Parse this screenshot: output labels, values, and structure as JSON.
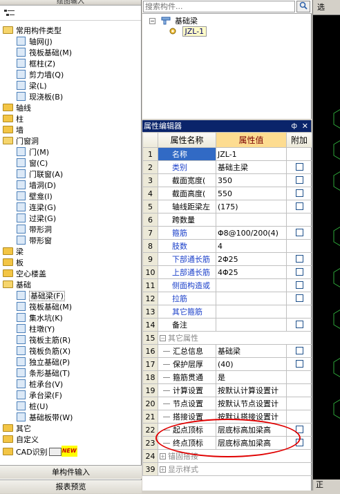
{
  "left_panel": {
    "top_title": "绘图输入",
    "tree": [
      {
        "label": "常用构件类型",
        "level": 0,
        "type": "folder"
      },
      {
        "label": "轴网(J)",
        "level": 1,
        "type": "item",
        "icon": "grid-icon"
      },
      {
        "label": "筏板基础(M)",
        "level": 1,
        "type": "item",
        "icon": "raft-icon"
      },
      {
        "label": "框柱(Z)",
        "level": 1,
        "type": "item",
        "icon": "column-icon"
      },
      {
        "label": "剪力墙(Q)",
        "level": 1,
        "type": "item",
        "icon": "wall-icon"
      },
      {
        "label": "梁(L)",
        "level": 1,
        "type": "item",
        "icon": "beam-icon"
      },
      {
        "label": "现浇板(B)",
        "level": 1,
        "type": "item",
        "icon": "slab-icon"
      },
      {
        "label": "轴线",
        "level": 0,
        "type": "folder"
      },
      {
        "label": "柱",
        "level": 0,
        "type": "folder"
      },
      {
        "label": "墙",
        "level": 0,
        "type": "folder"
      },
      {
        "label": "门窗洞",
        "level": 0,
        "type": "folder"
      },
      {
        "label": "门(M)",
        "level": 1,
        "type": "item",
        "icon": "door-icon"
      },
      {
        "label": "窗(C)",
        "level": 1,
        "type": "item",
        "icon": "window-icon"
      },
      {
        "label": "门联窗(A)",
        "level": 1,
        "type": "item",
        "icon": "door-window-icon"
      },
      {
        "label": "墙洞(D)",
        "level": 1,
        "type": "item",
        "icon": "wall-opening-icon"
      },
      {
        "label": "壁龛(I)",
        "level": 1,
        "type": "item",
        "icon": "niche-icon"
      },
      {
        "label": "连梁(G)",
        "level": 1,
        "type": "item",
        "icon": "coupling-beam-icon"
      },
      {
        "label": "过梁(G)",
        "level": 1,
        "type": "item",
        "icon": "lintel-icon"
      },
      {
        "label": "带形洞",
        "level": 1,
        "type": "item",
        "icon": "strip-opening-icon"
      },
      {
        "label": "带形窗",
        "level": 1,
        "type": "item",
        "icon": "strip-window-icon"
      },
      {
        "label": "梁",
        "level": 0,
        "type": "folder"
      },
      {
        "label": "板",
        "level": 0,
        "type": "folder"
      },
      {
        "label": "空心楼盖",
        "level": 0,
        "type": "folder"
      },
      {
        "label": "基础",
        "level": 0,
        "type": "folder"
      },
      {
        "label": "基础梁(F)",
        "level": 1,
        "type": "item",
        "icon": "foundation-beam-icon",
        "selected": true
      },
      {
        "label": "筏板基础(M)",
        "level": 1,
        "type": "item",
        "icon": "raft-icon"
      },
      {
        "label": "集水坑(K)",
        "level": 1,
        "type": "item",
        "icon": "sump-icon"
      },
      {
        "label": "柱墩(Y)",
        "level": 1,
        "type": "item",
        "icon": "pier-icon"
      },
      {
        "label": "筏板主筋(R)",
        "level": 1,
        "type": "item",
        "icon": "raft-main-rebar-icon"
      },
      {
        "label": "筏板负筋(X)",
        "level": 1,
        "type": "item",
        "icon": "raft-neg-rebar-icon"
      },
      {
        "label": "独立基础(P)",
        "level": 1,
        "type": "item",
        "icon": "isolated-footing-icon"
      },
      {
        "label": "条形基础(T)",
        "level": 1,
        "type": "item",
        "icon": "strip-footing-icon"
      },
      {
        "label": "桩承台(V)",
        "level": 1,
        "type": "item",
        "icon": "pile-cap-icon"
      },
      {
        "label": "承台梁(F)",
        "level": 1,
        "type": "item",
        "icon": "cap-beam-icon"
      },
      {
        "label": "桩(U)",
        "level": 1,
        "type": "item",
        "icon": "pile-icon"
      },
      {
        "label": "基础板带(W)",
        "level": 1,
        "type": "item",
        "icon": "foundation-strip-icon"
      },
      {
        "label": "其它",
        "level": 0,
        "type": "folder"
      },
      {
        "label": "自定义",
        "level": 0,
        "type": "folder"
      },
      {
        "label": "CAD识别",
        "level": 0,
        "type": "folder",
        "badge": "NEW"
      }
    ],
    "btn_single": "单构件输入",
    "btn_report": "报表预览"
  },
  "component_list": {
    "search_placeholder": "搜索构件...",
    "root_label": "基础梁",
    "child_label": "JZL-1"
  },
  "property_editor": {
    "title": "属性编辑器",
    "col_name": "属性名称",
    "col_value": "属性值",
    "col_extra": "附加",
    "rows": [
      {
        "num": "1",
        "name": "名称",
        "value": "JZL-1",
        "style": "sel",
        "check": false
      },
      {
        "num": "2",
        "name": "类别",
        "value": "基础主梁",
        "style": "blue",
        "check": true
      },
      {
        "num": "3",
        "name": "截面宽度(",
        "value": "350",
        "style": "",
        "check": true
      },
      {
        "num": "4",
        "name": "截面高度(",
        "value": "550",
        "style": "",
        "check": true
      },
      {
        "num": "5",
        "name": "轴线距梁左",
        "value": "(175)",
        "style": "",
        "check": true
      },
      {
        "num": "6",
        "name": "跨数量",
        "value": "",
        "style": "",
        "check": false
      },
      {
        "num": "7",
        "name": "箍筋",
        "value": "Φ8@100/200(4)",
        "style": "blue",
        "check": true
      },
      {
        "num": "8",
        "name": "肢数",
        "value": "4",
        "style": "blue",
        "check": false
      },
      {
        "num": "9",
        "name": "下部通长筋",
        "value": "2Φ25",
        "style": "blue",
        "check": true
      },
      {
        "num": "10",
        "name": "上部通长筋",
        "value": "4Φ25",
        "style": "blue",
        "check": true
      },
      {
        "num": "11",
        "name": "侧面构造或",
        "value": "",
        "style": "blue",
        "check": true
      },
      {
        "num": "12",
        "name": "拉筋",
        "value": "",
        "style": "blue",
        "check": true
      },
      {
        "num": "13",
        "name": "其它箍筋",
        "value": "",
        "style": "blue",
        "check": false
      },
      {
        "num": "14",
        "name": "备注",
        "value": "",
        "style": "",
        "check": true
      },
      {
        "num": "15",
        "name": "其它属性",
        "value": "",
        "style": "group",
        "check": false,
        "group": "−"
      },
      {
        "num": "16",
        "name": "汇总信息",
        "value": "基础梁",
        "style": "sub",
        "check": true
      },
      {
        "num": "17",
        "name": "保护层厚",
        "value": "(40)",
        "style": "sub",
        "check": true
      },
      {
        "num": "18",
        "name": "箍筋贯通",
        "value": "是",
        "style": "sub",
        "check": false
      },
      {
        "num": "19",
        "name": "计算设置",
        "value": "按默认计算设置计",
        "style": "sub",
        "check": false
      },
      {
        "num": "20",
        "name": "节点设置",
        "value": "按默认节点设置计",
        "style": "sub",
        "check": false
      },
      {
        "num": "21",
        "name": "搭接设置",
        "value": "按默认搭接设置计",
        "style": "sub",
        "check": false
      },
      {
        "num": "22",
        "name": "起点顶标",
        "value": "层底标高加梁高",
        "style": "sub",
        "check": true
      },
      {
        "num": "23",
        "name": "终点顶标",
        "value": "层底标高加梁高",
        "style": "sub",
        "check": true
      },
      {
        "num": "24",
        "name": "锚固搭接",
        "value": "",
        "style": "group",
        "check": false,
        "group": "+"
      },
      {
        "num": "39",
        "name": "显示样式",
        "value": "",
        "style": "group",
        "check": false,
        "group": "+"
      }
    ]
  },
  "right_panel": {
    "top_text": "选",
    "bottom_text": "正"
  }
}
